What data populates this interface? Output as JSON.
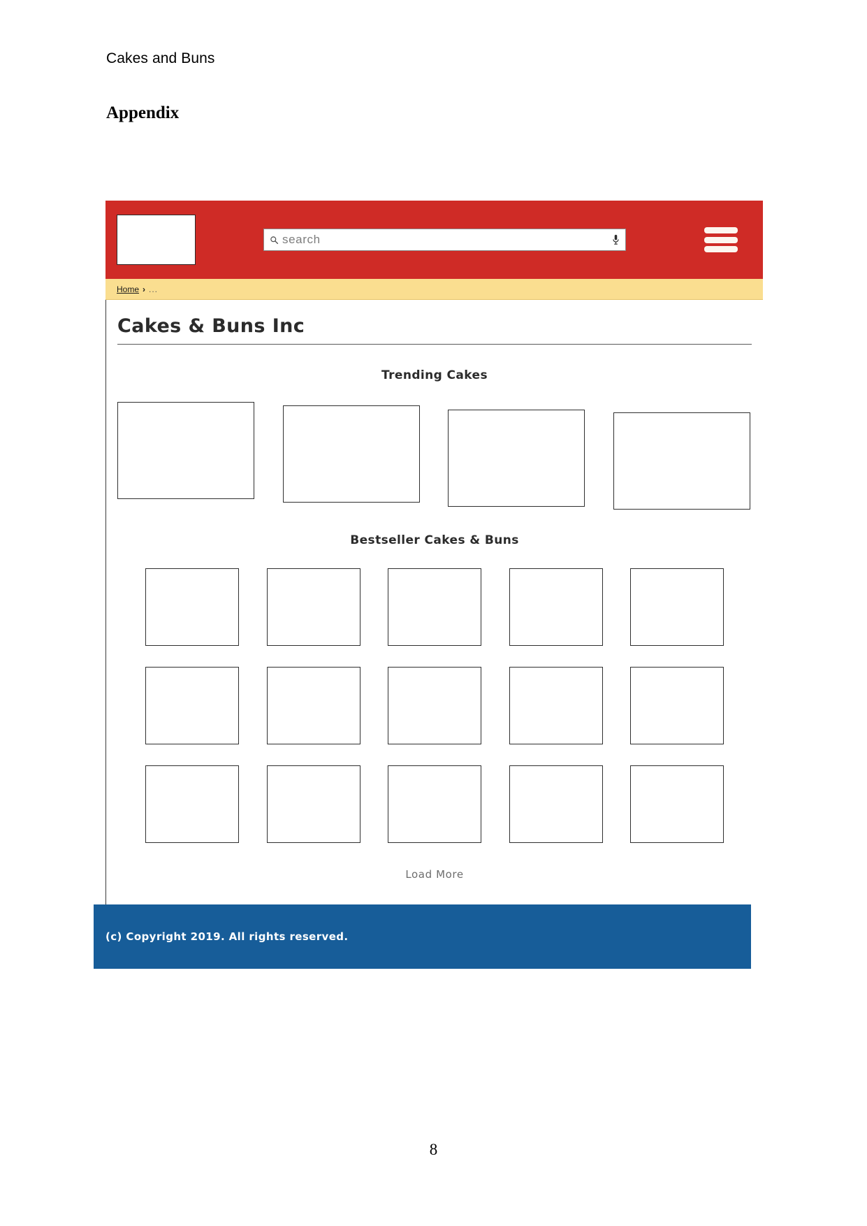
{
  "document": {
    "running_head": "Cakes and Buns",
    "appendix_heading": "Appendix",
    "page_number": "8"
  },
  "colors": {
    "navbar_red": "#cf2b26",
    "breadcrumb_yellow": "#fade90",
    "footer_blue": "#175d99",
    "card_border": "#2f2f2f",
    "muted_text": "#6d6d6d"
  },
  "navbar": {
    "logo_alt": "logo-placeholder",
    "search": {
      "placeholder": "search",
      "value": "",
      "search_icon": "search-icon",
      "mic_icon": "microphone-icon"
    },
    "menu_icon": "hamburger-menu-icon"
  },
  "breadcrumb": {
    "home_label": "Home",
    "separator": "›",
    "tail": "..."
  },
  "page": {
    "site_title": "Cakes & Buns Inc",
    "sections": [
      {
        "heading": "Trending Cakes",
        "card_count": 4
      },
      {
        "heading": "Bestseller Cakes & Buns",
        "card_count": 15
      }
    ],
    "load_more_label": "Load More"
  },
  "footer": {
    "copyright": "(c) Copyright 2019. All rights reserved."
  }
}
